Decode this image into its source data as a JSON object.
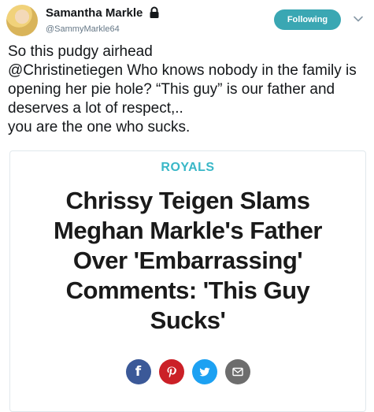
{
  "tweet": {
    "display_name": "Samantha Markle",
    "handle": "@SammyMarkle64",
    "follow_label": "Following",
    "text": "So this pudgy airhead\n@Christinetiegen  Who knows nobody in the family is opening her pie hole? “This guy”  is our father and deserves a lot of respect,..\nyou are the one who sucks."
  },
  "card": {
    "category": "ROYALS",
    "headline": "Chrissy Teigen Slams Meghan Markle's Father Over 'Embarrassing' Comments: 'This Guy Sucks'",
    "share_buttons": [
      {
        "icon": "facebook-icon",
        "glyph": "f",
        "color": "#3b5998"
      },
      {
        "icon": "pinterest-icon",
        "glyph": "P",
        "color": "#cb2027"
      },
      {
        "icon": "twitter-icon",
        "glyph": "",
        "color": "#1da1f2"
      },
      {
        "icon": "email-icon",
        "glyph": "",
        "color": "#6d6d6d"
      }
    ]
  },
  "colors": {
    "follow_button": "#3aa7b3",
    "category": "#39b7c7",
    "handle": "#657786"
  }
}
